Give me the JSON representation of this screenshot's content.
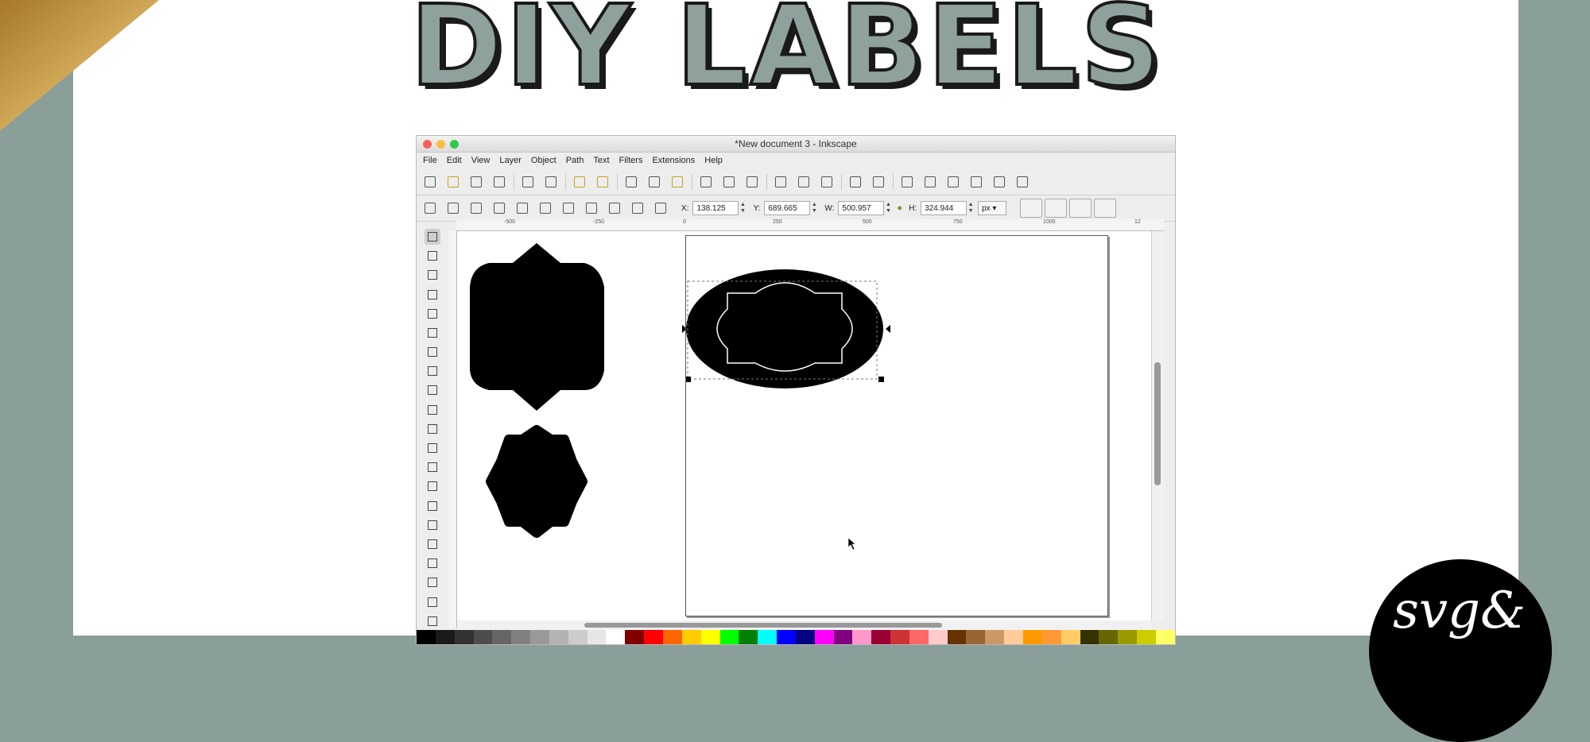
{
  "banner": {
    "title": "DIY LABELS",
    "badge_text": "svg&"
  },
  "app": {
    "window_title": "*New document 3 - Inkscape",
    "menu": [
      "File",
      "Edit",
      "View",
      "Layer",
      "Object",
      "Path",
      "Text",
      "Filters",
      "Extensions",
      "Help"
    ],
    "commands_toolbar": [
      "new-doc-icon",
      "open-icon",
      "save-icon",
      "print-icon",
      "import-icon",
      "export-icon",
      "undo-icon",
      "redo-icon",
      "duplicate-icon",
      "cut-icon",
      "paste-icon",
      "zoom-selection-icon",
      "zoom-drawing-icon",
      "zoom-page-icon",
      "group-icon",
      "ungroup-icon",
      "align-icon",
      "node-editor-icon",
      "xml-editor-icon",
      "text-tool-icon",
      "layers-icon",
      "fill-stroke-icon",
      "align-distribute-icon",
      "preferences-icon",
      "transform-icon"
    ],
    "controls": {
      "x_label": "X:",
      "x_value": "138.125",
      "y_label": "Y:",
      "y_value": "689.665",
      "w_label": "W:",
      "w_value": "500.957",
      "h_label": "H:",
      "h_value": "324.944",
      "unit": "px"
    },
    "ruler_ticks": [
      "-500",
      "-250",
      "0",
      "250",
      "500",
      "750",
      "1000",
      "12"
    ],
    "tools": [
      "select-icon",
      "node-icon",
      "tweak-icon",
      "zoom-icon",
      "measure-icon",
      "rect-icon",
      "3dbox-icon",
      "ellipse-icon",
      "star-icon",
      "spiral-icon",
      "pencil-icon",
      "pen-icon",
      "calligraphy-icon",
      "text-icon",
      "spray-icon",
      "eraser-icon",
      "bucket-icon",
      "gradient-icon",
      "mesh-icon",
      "dropper-icon",
      "connector-icon"
    ],
    "palette": [
      "#000000",
      "#1a1a1a",
      "#333333",
      "#4d4d4d",
      "#666666",
      "#808080",
      "#999999",
      "#b3b3b3",
      "#cccccc",
      "#e6e6e6",
      "#ffffff",
      "#800000",
      "#ff0000",
      "#ff6600",
      "#ffcc00",
      "#ffff00",
      "#00ff00",
      "#008000",
      "#00ffff",
      "#0000ff",
      "#000080",
      "#ff00ff",
      "#800080",
      "#ff99cc",
      "#990033",
      "#cc3333",
      "#ff6666",
      "#ffcccc",
      "#663300",
      "#996633",
      "#cc9966",
      "#ffcc99",
      "#ff9900",
      "#ff9933",
      "#ffcc66",
      "#333300",
      "#666600",
      "#999900",
      "#cccc00",
      "#ffff66"
    ]
  }
}
